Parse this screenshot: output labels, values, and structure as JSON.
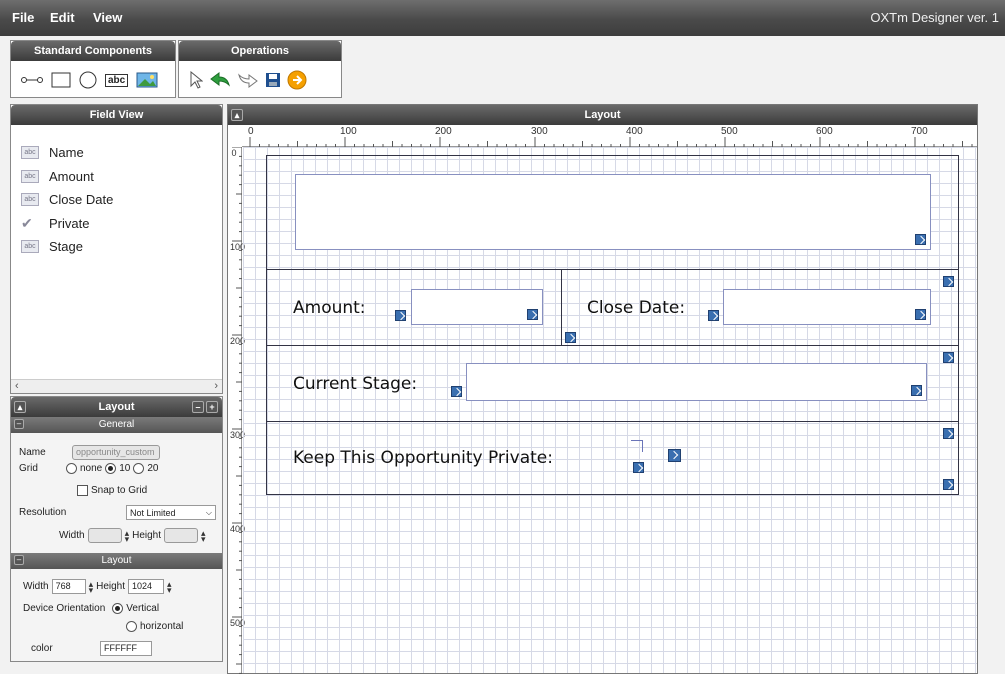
{
  "menu": {
    "file": "File",
    "edit": "Edit",
    "view": "View",
    "app_title": "OXTm Designer ver. 1"
  },
  "standard_components": {
    "title": "Standard Components",
    "tools": [
      "connector",
      "rectangle",
      "circle",
      "label",
      "image"
    ],
    "label_text": "abc"
  },
  "operations": {
    "title": "Operations",
    "tools": [
      "pointer",
      "undo",
      "redo",
      "save",
      "next"
    ]
  },
  "field_view": {
    "title": "Field View",
    "items": [
      {
        "label": "Name",
        "icon": "text-field-icon"
      },
      {
        "label": "Amount",
        "icon": "text-field-icon"
      },
      {
        "label": "Close Date",
        "icon": "text-field-icon"
      },
      {
        "label": "Private",
        "icon": "checkbox-icon"
      },
      {
        "label": "Stage",
        "icon": "text-field-icon"
      }
    ],
    "icon_text": "abc"
  },
  "properties": {
    "title": "Layout",
    "general": {
      "title": "General",
      "name_label": "Name",
      "name_value": "opportunity_custom",
      "grid_label": "Grid",
      "grid_options": [
        "none",
        "10",
        "20"
      ],
      "grid_selected": "10",
      "snap_label": "Snap to Grid",
      "resolution_label": "Resolution",
      "resolution_value": "Not Limited",
      "width_label": "Width",
      "height_label": "Height"
    },
    "layout": {
      "title": "Layout",
      "width_label": "Width",
      "width_value": "768",
      "height_label": "Height",
      "height_value": "1024",
      "orientation_label": "Device Orientation",
      "orientation_options": [
        "Vertical",
        "horizontal"
      ],
      "orientation_selected": "Vertical",
      "color_label": "color",
      "color_value": "FFFFFF"
    }
  },
  "canvas": {
    "title": "Layout",
    "ruler_top": [
      "0",
      "100",
      "200",
      "300",
      "400",
      "500",
      "600",
      "700"
    ],
    "ruler_left": [
      "0",
      "100",
      "200",
      "300",
      "400",
      "500"
    ],
    "labels": {
      "amount": "Amount:",
      "close_date": "Close Date:",
      "current_stage": "Current Stage:",
      "private": "Keep This Opportunity Private:"
    }
  },
  "colors": {
    "menubar": "#4a4a4a",
    "grid": "#d6d9e6",
    "accent": "#3a6fb0",
    "save_icon": "#1f4f8f",
    "next_icon": "#f5a000"
  }
}
